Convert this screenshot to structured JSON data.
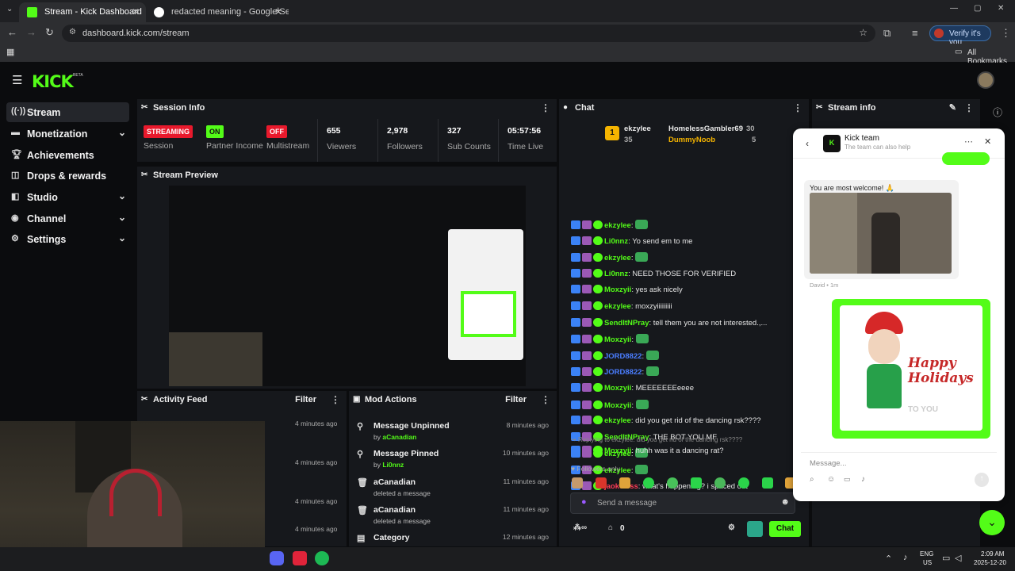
{
  "browser": {
    "tabs": [
      {
        "title": "Stream - Kick Dashboard",
        "active": true
      },
      {
        "title": "redacted meaning - Google Se",
        "active": false
      }
    ],
    "url": "dashboard.kick.com/stream",
    "verify_label": "Verify it's you",
    "bookmarks_label": "All Bookmarks"
  },
  "brand": {
    "logo": "KICK",
    "beta": "BETA",
    "accent": "#53fc18"
  },
  "sidebar": {
    "items": [
      {
        "label": "Stream",
        "icon": "stream-icon",
        "active": true
      },
      {
        "label": "Monetization",
        "icon": "monetization-icon",
        "expandable": true
      },
      {
        "label": "Achievements",
        "icon": "trophy-icon"
      },
      {
        "label": "Drops & rewards",
        "icon": "gift-icon"
      },
      {
        "label": "Studio",
        "icon": "studio-icon",
        "expandable": true
      },
      {
        "label": "Channel",
        "icon": "channel-icon",
        "expandable": true
      },
      {
        "label": "Settings",
        "icon": "gear-icon",
        "expandable": true
      }
    ]
  },
  "session_info": {
    "title": "Session Info",
    "stats": [
      {
        "value": "STREAMING",
        "label": "Session",
        "badge_color": "#e8192c"
      },
      {
        "value": "ON",
        "label": "Partner Income",
        "badge_color": "#53fc18"
      },
      {
        "value": "OFF",
        "label": "Multistream",
        "badge_color": "#e8192c"
      },
      {
        "value": "655",
        "label": "Viewers"
      },
      {
        "value": "2,978",
        "label": "Followers"
      },
      {
        "value": "327",
        "label": "Sub Counts"
      },
      {
        "value": "05:57:56",
        "label": "Time Live"
      }
    ]
  },
  "stream_preview": {
    "title": "Stream Preview"
  },
  "activity_feed": {
    "title": "Activity Feed",
    "filter_label": "Filter",
    "times": [
      "4 minutes ago",
      "4 minutes ago",
      "4 minutes ago",
      "4 minutes ago"
    ]
  },
  "mod_actions": {
    "title": "Mod Actions",
    "filter_label": "Filter",
    "items": [
      {
        "action": "Message Unpinned",
        "by_prefix": "by ",
        "by": "aCanadian",
        "time": "8 minutes ago",
        "icon": "unpin-icon"
      },
      {
        "action": "Message Pinned",
        "by_prefix": "by ",
        "by": "Li0nnz",
        "time": "10 minutes ago",
        "icon": "pin-icon"
      },
      {
        "action": "aCanadian",
        "by_prefix": "",
        "by": "deleted a message",
        "time": "11 minutes ago",
        "icon": "trash-icon"
      },
      {
        "action": "aCanadian",
        "by_prefix": "",
        "by": "deleted a message",
        "time": "11 minutes ago",
        "icon": "trash-icon"
      },
      {
        "action": "Category",
        "by_prefix": "",
        "by": "",
        "time": "12 minutes ago",
        "icon": "category-icon"
      }
    ]
  },
  "chat": {
    "title": "Chat",
    "leaderboard": [
      {
        "name": "ekzylee",
        "count": "35"
      },
      {
        "name": "HomelessGambler69",
        "count": "30"
      },
      {
        "name": "DummyNoob",
        "count": "5"
      }
    ],
    "messages": [
      {
        "user": "ekzylee",
        "text": "",
        "color": "green"
      },
      {
        "user": "Li0nnz",
        "text": "Yo send em to me",
        "color": "green"
      },
      {
        "user": "ekzylee",
        "text": "",
        "color": "green"
      },
      {
        "user": "Li0nnz",
        "text": "NEED THOSE FOR VERIFIED",
        "color": "green"
      },
      {
        "user": "Moxzyii",
        "text": "yes ask nicely",
        "color": "green"
      },
      {
        "user": "ekzylee",
        "text": "moxzyiiiiiiiii",
        "color": "green"
      },
      {
        "user": "SendItNPray",
        "text": "tell them you are not interested.,...",
        "color": "green"
      },
      {
        "user": "Moxzyii",
        "text": "",
        "color": "green"
      },
      {
        "user": "JORD8822",
        "text": "",
        "color": "blue"
      },
      {
        "user": "JORD8822",
        "text": "",
        "color": "blue"
      },
      {
        "user": "Moxzyii",
        "text": "MEEEEEEEeeee",
        "color": "green"
      },
      {
        "user": "Moxzyii",
        "text": "",
        "color": "green"
      },
      {
        "user": "ekzylee",
        "text": "did you get rid of the dancing rsk????",
        "color": "green"
      },
      {
        "user": "SendItNPray",
        "text": "THE BOT YOU MF",
        "color": "green"
      },
      {
        "user": "ekzylee",
        "text": "",
        "color": "green"
      },
      {
        "user": "ekzylee",
        "text": "",
        "color": "green"
      },
      {
        "user": "jaok6less",
        "text": "what's happening? i spaced out",
        "color": "red"
      }
    ],
    "reply_context": "Replying to ekzylee: did you get rid of the dancing rsk????",
    "reply_message": {
      "user": "Moxzyii",
      "text": "huhh was it a dancing rat?"
    },
    "followers_only": "Followers only",
    "input_placeholder": "Send a message",
    "count_value": "0",
    "chat_button": "Chat"
  },
  "stream_info": {
    "title": "Stream info"
  },
  "support": {
    "title": "Kick team",
    "subtitle": "The team can also help",
    "message": "You are most welcome! 🙏",
    "sender": "David • 1m",
    "card_text": "Happy Holidays",
    "card_sub": "TO YOU",
    "input_placeholder": "Message..."
  },
  "taskbar": {
    "lang": "ENG",
    "region": "US",
    "time": "2:09 AM",
    "date": "2025-12-20"
  }
}
